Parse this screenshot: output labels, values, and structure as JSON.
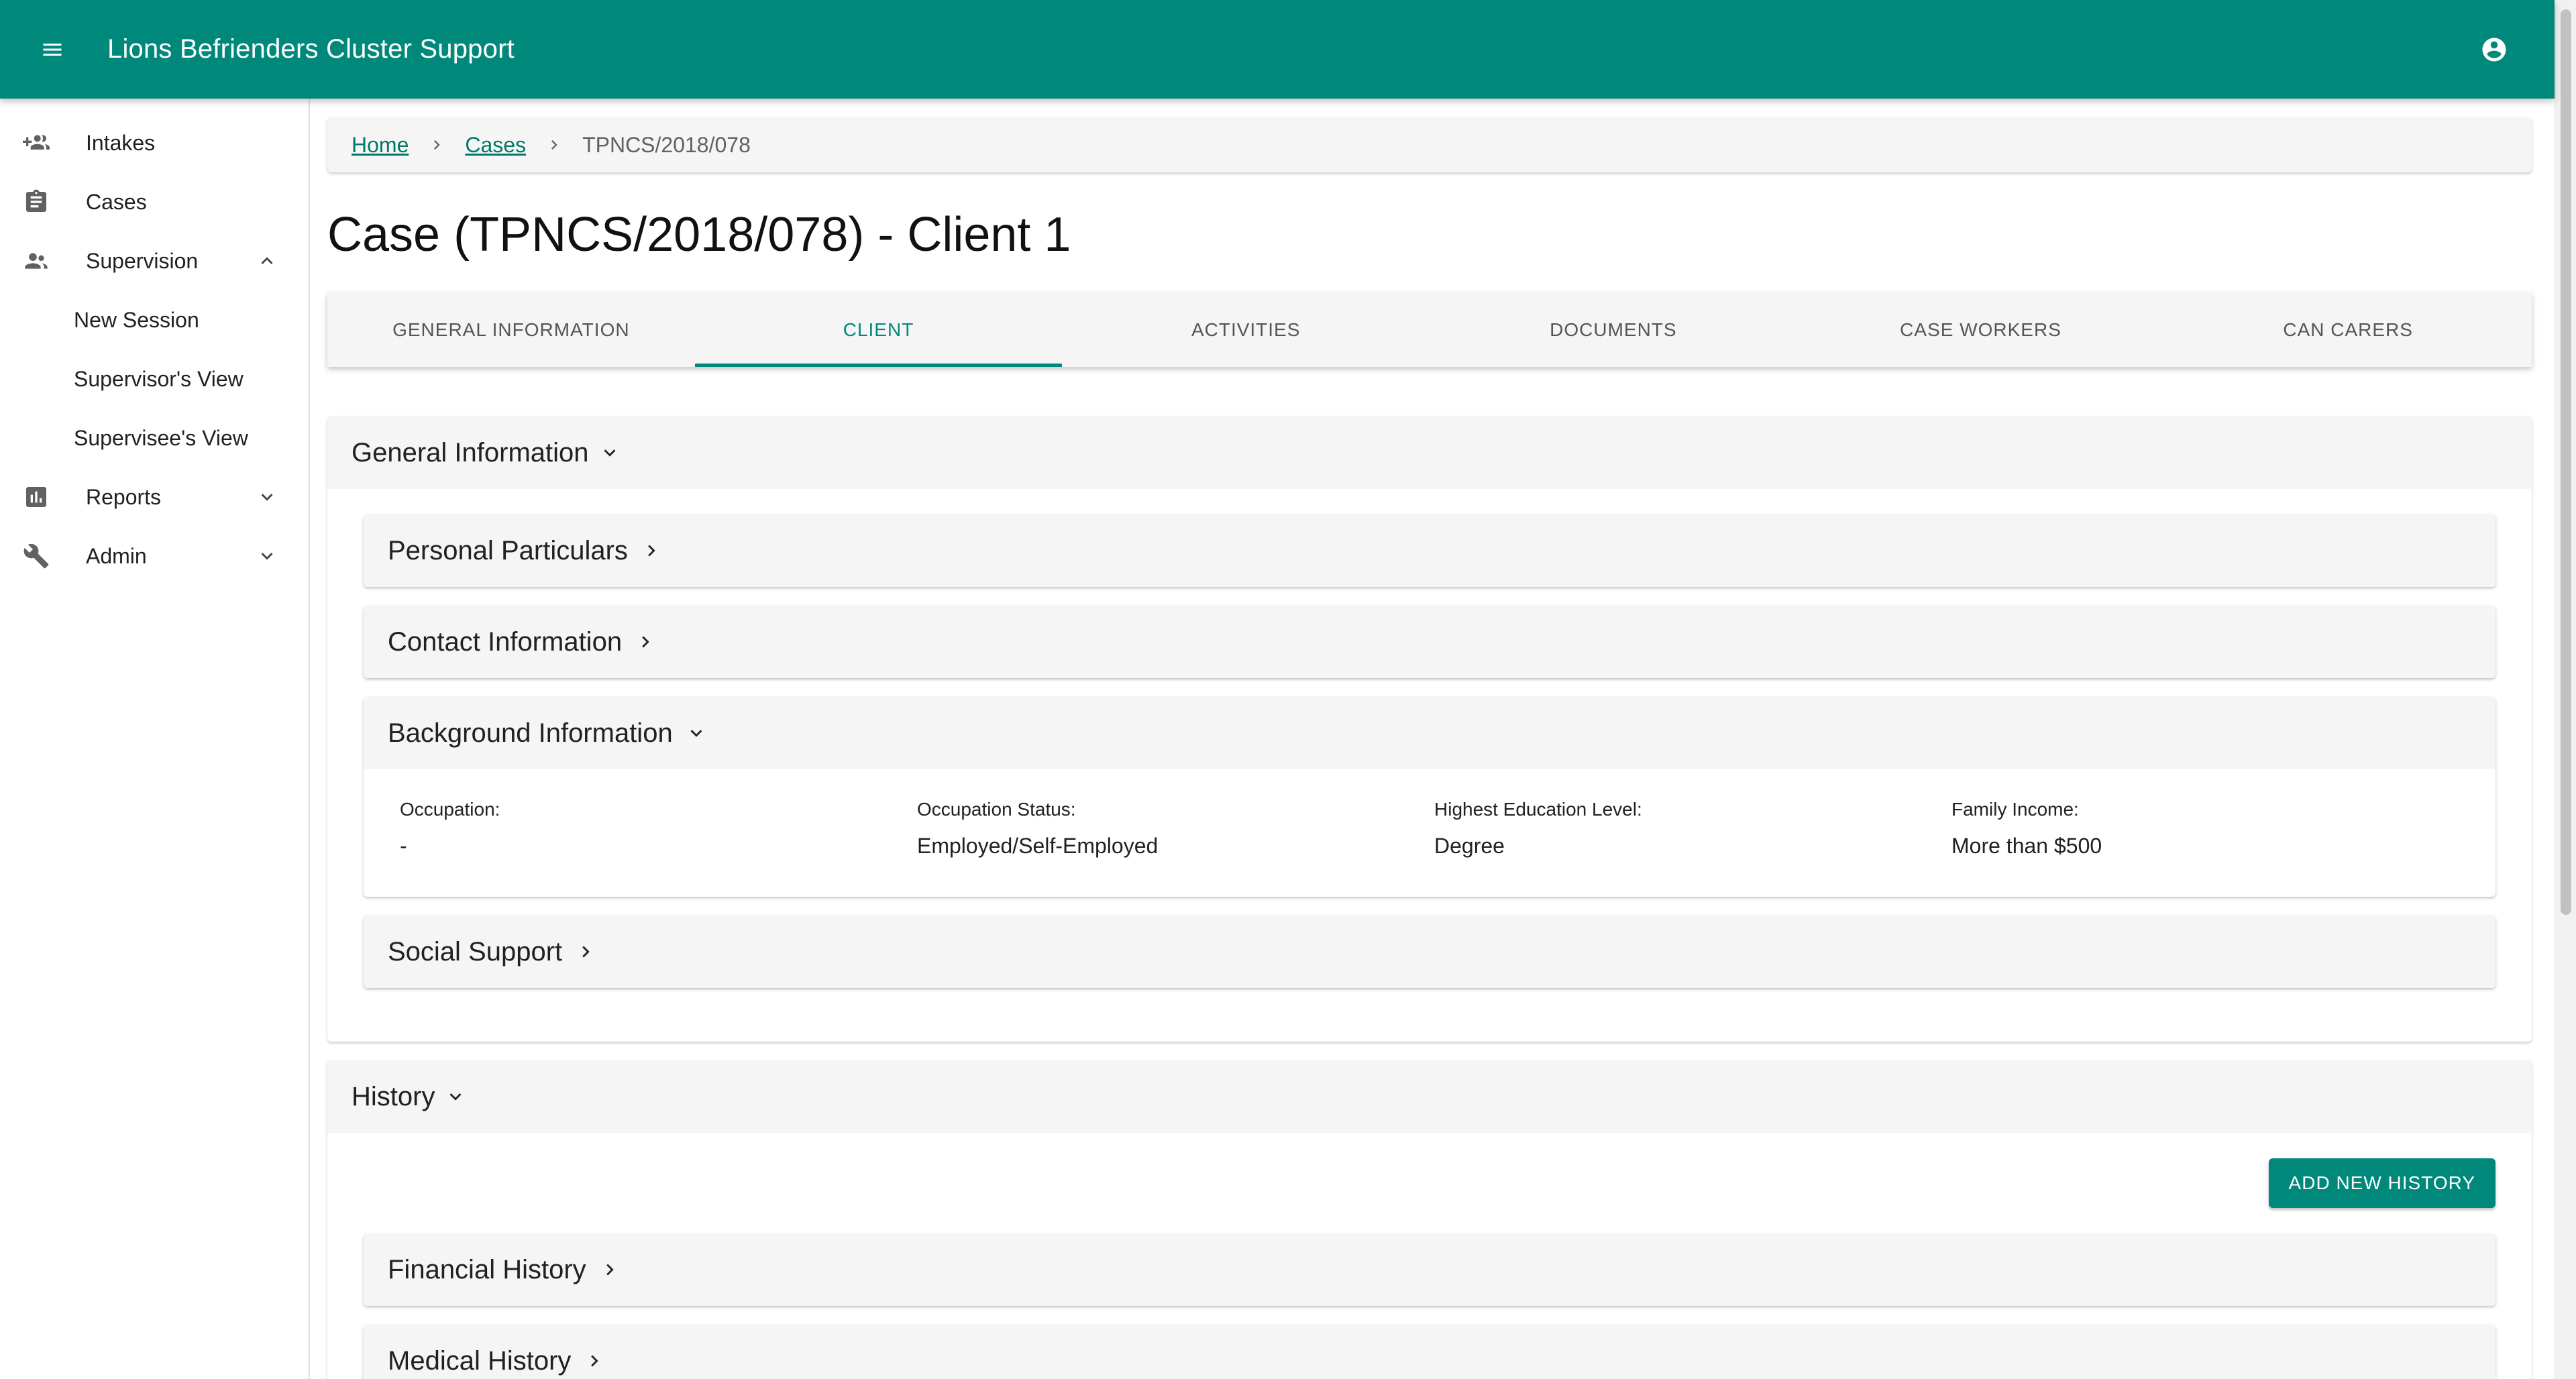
{
  "app": {
    "title": "Lions Befrienders Cluster Support",
    "accent_color": "#00897b",
    "menu_icon": "menu-icon",
    "account_icon": "account-circle-icon"
  },
  "sidebar": {
    "items": [
      {
        "label": "Intakes",
        "icon": "group-add-icon"
      },
      {
        "label": "Cases",
        "icon": "assignment-icon"
      },
      {
        "label": "Supervision",
        "icon": "supervisor-icon",
        "expanded": true,
        "children": [
          "New Session",
          "Supervisor's View",
          "Supervisee's View"
        ]
      },
      {
        "label": "Reports",
        "icon": "bar-chart-icon",
        "expanded": false
      },
      {
        "label": "Admin",
        "icon": "wrench-icon",
        "expanded": false
      }
    ]
  },
  "breadcrumb": {
    "home": "Home",
    "cases": "Cases",
    "current": "TPNCS/2018/078"
  },
  "page": {
    "title": "Case (TPNCS/2018/078) - Client 1"
  },
  "tabs": [
    {
      "label": "GENERAL INFORMATION",
      "active": false
    },
    {
      "label": "CLIENT",
      "active": true
    },
    {
      "label": "ACTIVITIES",
      "active": false
    },
    {
      "label": "DOCUMENTS",
      "active": false
    },
    {
      "label": "CASE WORKERS",
      "active": false
    },
    {
      "label": "CAN CARERS",
      "active": false
    }
  ],
  "general_information": {
    "title": "General Information",
    "sections": {
      "personal": "Personal Particulars",
      "contact": "Contact Information",
      "background": {
        "title": "Background Information",
        "fields": [
          {
            "label": "Occupation:",
            "value": "-"
          },
          {
            "label": "Occupation Status:",
            "value": "Employed/Self-Employed"
          },
          {
            "label": "Highest Education Level:",
            "value": "Degree"
          },
          {
            "label": "Family Income:",
            "value": "More than $500"
          }
        ]
      },
      "social": "Social Support"
    }
  },
  "history": {
    "title": "History",
    "add_button": "ADD NEW HISTORY",
    "sections": {
      "financial": "Financial History",
      "medical": "Medical History"
    }
  }
}
